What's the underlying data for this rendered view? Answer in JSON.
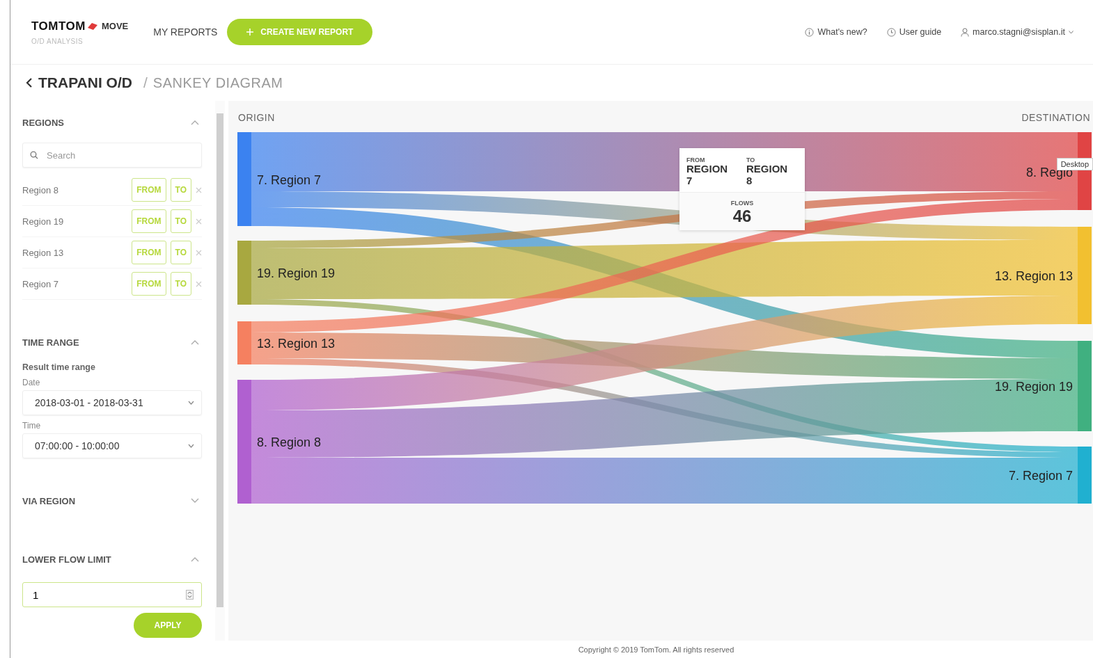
{
  "header": {
    "logo": "TOMTOM",
    "product": "MOVE",
    "subtitle": "O/D ANALYSIS",
    "nav": "MY REPORTS",
    "create_button": "CREATE NEW REPORT",
    "whats_new": "What's new?",
    "user_guide": "User guide",
    "user": "marco.stagni@sisplan.it"
  },
  "breadcrumb": {
    "parent": "TRAPANI O/D",
    "separator": "/",
    "current": "SANKEY DIAGRAM"
  },
  "sidebar": {
    "sections": [
      {
        "kind": "regions",
        "title": "REGIONS",
        "expanded": true,
        "search_placeholder": "Search",
        "items": [
          {
            "name": "Region 8",
            "from": "FROM",
            "to": "TO"
          },
          {
            "name": "Region 19",
            "from": "FROM",
            "to": "TO"
          },
          {
            "name": "Region 13",
            "from": "FROM",
            "to": "TO"
          },
          {
            "name": "Region 7",
            "from": "FROM",
            "to": "TO"
          }
        ]
      },
      {
        "kind": "time_range",
        "title": "TIME RANGE",
        "expanded": true,
        "subtitle": "Result time range",
        "date_label": "Date",
        "date_value": "2018-03-01 - 2018-03-31",
        "time_label": "Time",
        "time_value": "07:00:00 - 10:00:00"
      },
      {
        "kind": "via_region",
        "title": "VIA REGION",
        "expanded": false
      },
      {
        "kind": "flow_limit",
        "title": "LOWER FLOW LIMIT",
        "expanded": true,
        "value": "1",
        "apply": "APPLY"
      }
    ]
  },
  "sankey": {
    "origin_title": "ORIGIN",
    "destination_title": "DESTINATION",
    "origins": [
      {
        "label": "7. Region 7",
        "color": "#3b82f0"
      },
      {
        "label": "19. Region 19",
        "color": "#a8a840"
      },
      {
        "label": "13. Region 13",
        "color": "#f58060"
      },
      {
        "label": "8. Region 8",
        "color": "#b060d0"
      }
    ],
    "destinations": [
      {
        "label": "8. Regio",
        "color": "#e04444"
      },
      {
        "label": "13. Region 13",
        "color": "#f2c030"
      },
      {
        "label": "19. Region 19",
        "color": "#40b080"
      },
      {
        "label": "7. Region 7",
        "color": "#20b0d0"
      }
    ],
    "tooltip": {
      "from_label": "FROM",
      "from_value": "REGION 7",
      "to_label": "TO",
      "to_value": "REGION 8",
      "flows_label": "FLOWS",
      "flows_value": "46"
    },
    "hover_label": "Desktop"
  },
  "footer": "Copyright © 2019 TomTom. All rights reserved"
}
